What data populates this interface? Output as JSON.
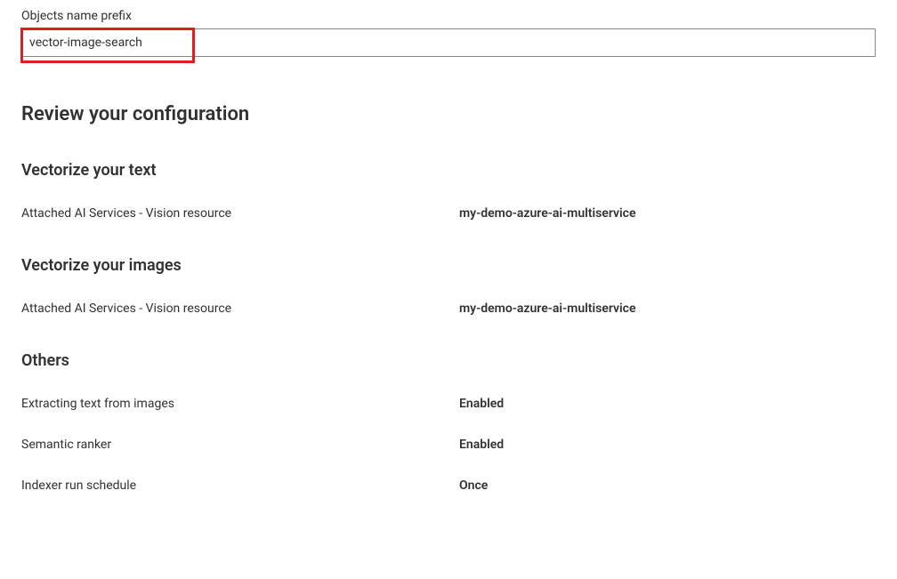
{
  "prefix": {
    "label": "Objects name prefix",
    "value": "vector-image-search"
  },
  "review": {
    "title": "Review your configuration",
    "vectorize_text": {
      "title": "Vectorize your text",
      "rows": [
        {
          "label": "Attached AI Services - Vision resource",
          "value": "my-demo-azure-ai-multiservice"
        }
      ]
    },
    "vectorize_images": {
      "title": "Vectorize your images",
      "rows": [
        {
          "label": "Attached AI Services - Vision resource",
          "value": "my-demo-azure-ai-multiservice"
        }
      ]
    },
    "others": {
      "title": "Others",
      "rows": [
        {
          "label": "Extracting text from images",
          "value": "Enabled"
        },
        {
          "label": "Semantic ranker",
          "value": "Enabled"
        },
        {
          "label": "Indexer run schedule",
          "value": "Once"
        }
      ]
    }
  }
}
